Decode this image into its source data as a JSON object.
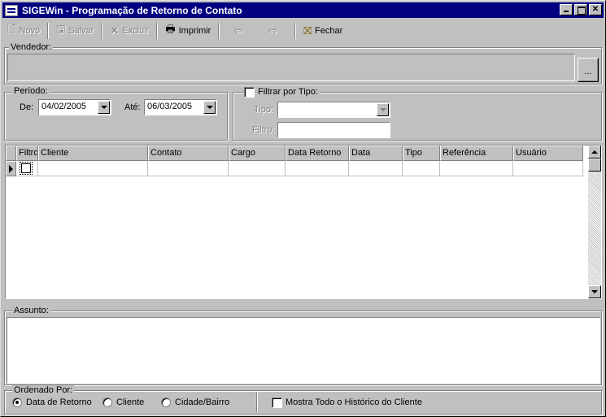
{
  "window": {
    "title": "SIGEWin - Programação de Retorno de Contato",
    "minimize": "_",
    "maximize": "□",
    "close": "✕"
  },
  "toolbar": {
    "novo": "Novo",
    "salvar": "Salvar",
    "excluir": "Excluir",
    "imprimir": "Imprimir",
    "fechar": "Fechar"
  },
  "vendedor": {
    "label": "Vendedor:",
    "lookup_button": "..."
  },
  "periodo": {
    "label": "Período:",
    "de_label": "De:",
    "de_value": "04/02/2005",
    "ate_label": "Até:",
    "ate_value": "06/03/2005"
  },
  "filtro_tipo": {
    "label": "Filtrar por Tipo:",
    "tipo_label": "Tipo:",
    "filtro_label": "Filtro:"
  },
  "grid": {
    "columns": [
      "Filtro",
      "Cliente",
      "Contato",
      "Cargo",
      "Data Retorno",
      "Data",
      "Tipo",
      "Referência",
      "Usuário"
    ]
  },
  "assunto": {
    "label": "Assunto:"
  },
  "ordenado": {
    "label": "Ordenado Por:",
    "options": [
      "Data de Retorno",
      "Cliente",
      "Cidade/Bairro"
    ],
    "selected": "Data de Retorno",
    "historico_label": "Mostra Todo o Histórico do Cliente"
  }
}
